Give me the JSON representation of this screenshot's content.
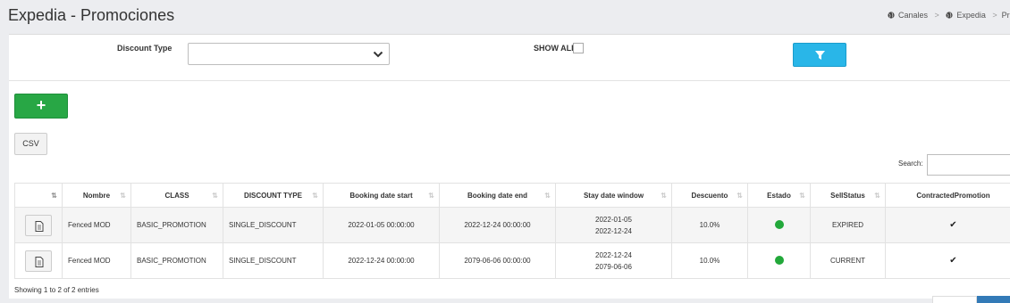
{
  "header": {
    "title": "Expedia - Promociones",
    "breadcrumb": [
      "Canales",
      "Expedia",
      "Pron"
    ]
  },
  "filters": {
    "discount_type_label": "Discount Type",
    "discount_type_value": "",
    "show_all_label": "SHOW ALL",
    "show_all_checked": false
  },
  "actions": {
    "add_label": "+",
    "csv_label": "CSV"
  },
  "search": {
    "label": "Search:",
    "value": ""
  },
  "table": {
    "columns": [
      "",
      "Nombre",
      "CLASS",
      "DISCOUNT TYPE",
      "Booking date start",
      "Booking date end",
      "Stay date window",
      "Descuento",
      "Estado",
      "SellStatus",
      "ContractedPromotion"
    ],
    "rows": [
      {
        "nombre": "Fenced MOD",
        "class": "BASIC_PROMOTION",
        "discount_type": "SINGLE_DISCOUNT",
        "booking_start": "2022-01-05 00:00:00",
        "booking_end": "2022-12-24 00:00:00",
        "stay_from": "2022-01-05",
        "stay_to": "2022-12-24",
        "descuento": "10.0%",
        "estado": "active",
        "sell_status": "EXPIRED",
        "contracted": "✔"
      },
      {
        "nombre": "Fenced MOD",
        "class": "BASIC_PROMOTION",
        "discount_type": "SINGLE_DISCOUNT",
        "booking_start": "2022-12-24 00:00:00",
        "booking_end": "2079-06-06 00:00:00",
        "stay_from": "2022-12-24",
        "stay_to": "2079-06-06",
        "descuento": "10.0%",
        "estado": "active",
        "sell_status": "CURRENT",
        "contracted": "✔"
      }
    ]
  },
  "footer": {
    "info": "Showing 1 to 2 of 2 entries"
  },
  "colors": {
    "primary_blue": "#29b6e8",
    "success_green": "#28a745",
    "status_dot": "#22a83a",
    "header_bg": "#ecedf0"
  },
  "icons": [
    "globe-icon",
    "chevron-down-icon",
    "filter-icon",
    "plus-icon",
    "document-icon",
    "sort-icon",
    "check-icon"
  ]
}
